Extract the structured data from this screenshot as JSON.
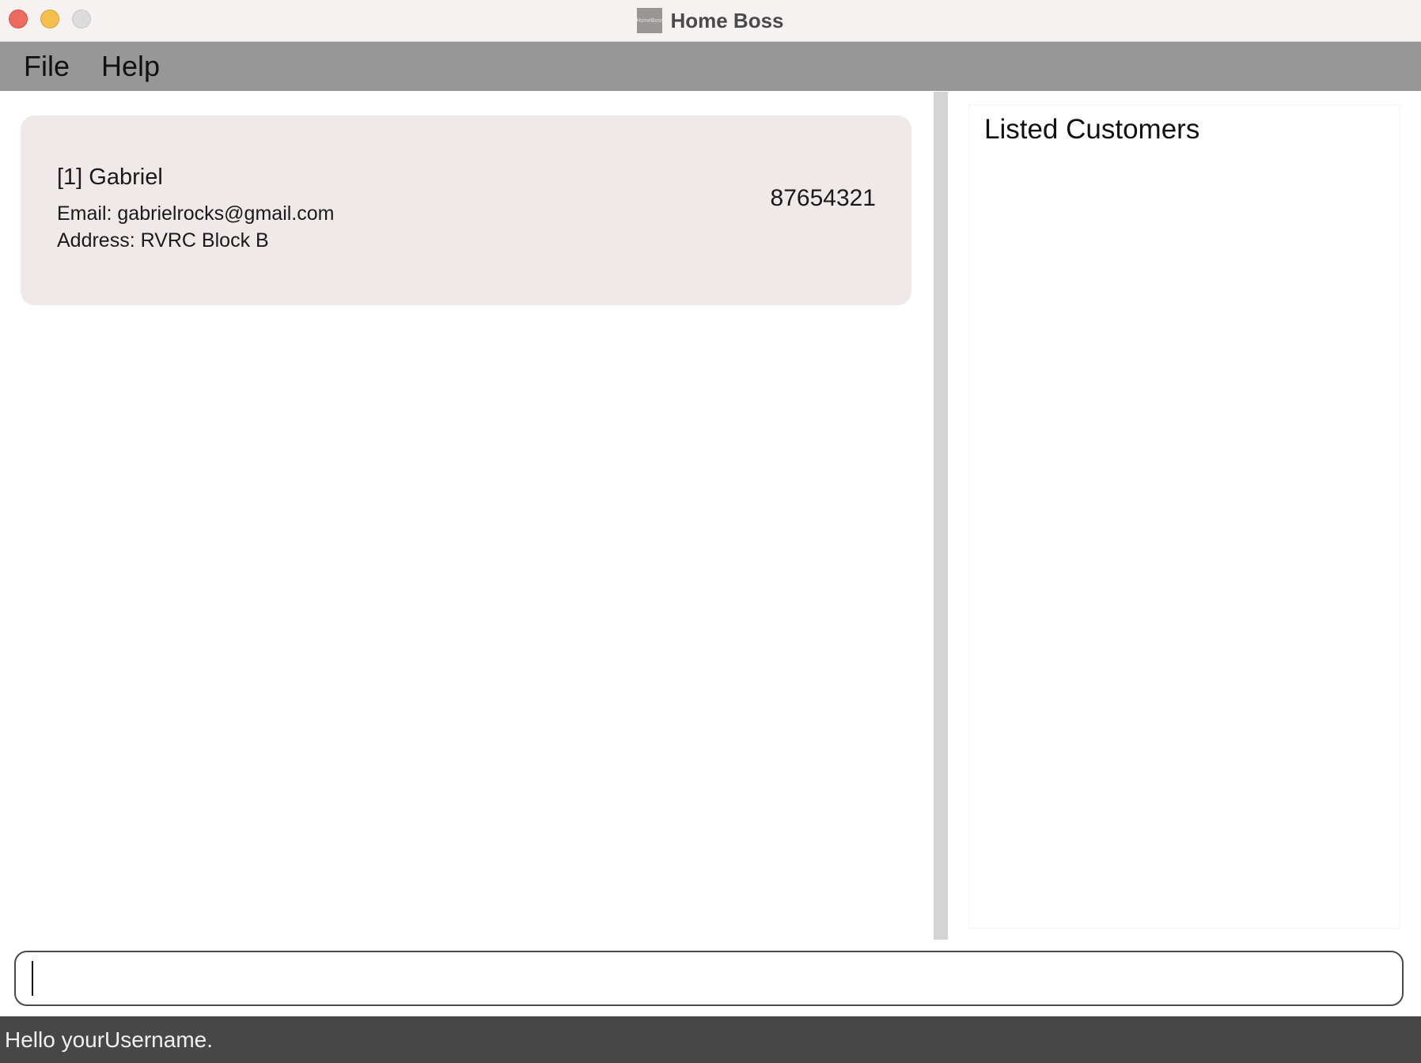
{
  "window": {
    "title": "Home Boss",
    "app_icon_text": "HomeBoss"
  },
  "menu": {
    "items": [
      {
        "label": "File"
      },
      {
        "label": "Help"
      }
    ]
  },
  "customers": [
    {
      "name": "[1] Gabriel",
      "phone": "87654321",
      "email": "Email: gabrielrocks@gmail.com",
      "address": "Address: RVRC Block B"
    }
  ],
  "right_panel": {
    "heading": "Listed Customers"
  },
  "command": {
    "value": "",
    "placeholder": ""
  },
  "status": {
    "text": "Hello yourUsername."
  },
  "colors": {
    "titlebar": "#f6f2f2",
    "menubar": "#979797",
    "card": "#efe9e9",
    "statusbar": "#474747",
    "close": "#ed6a5e",
    "minimize": "#f5bf4f",
    "zoom": "#dcdcdc"
  }
}
